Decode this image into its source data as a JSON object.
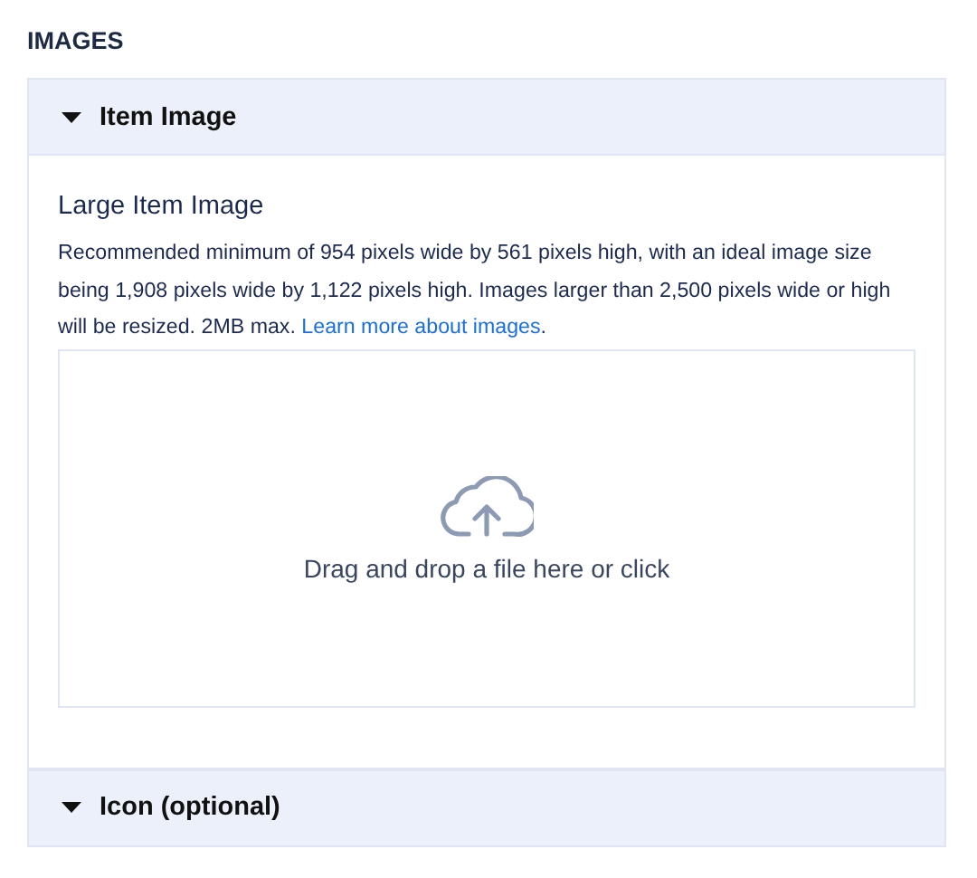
{
  "heading": "IMAGES",
  "sections": [
    {
      "title": "Item Image",
      "field": {
        "label": "Large Item Image",
        "description": "Recommended minimum of 954 pixels wide by 561 pixels high, with an ideal image size being 1,908 pixels wide by 1,122 pixels high. Images larger than 2,500 pixels wide or high will be resized. 2MB max. ",
        "link": "Learn more about images",
        "after_link": ".",
        "dropzone": "Drag and drop a file here or click"
      }
    },
    {
      "title": "Icon (optional)"
    }
  ]
}
